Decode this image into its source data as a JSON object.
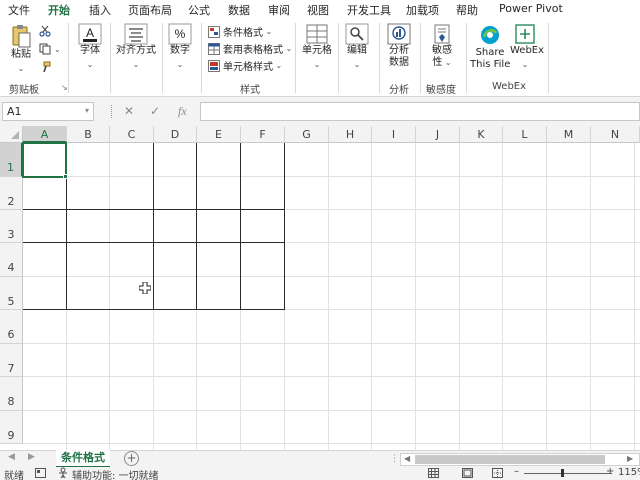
{
  "menu": {
    "tabs": [
      "文件",
      "开始",
      "插入",
      "页面布局",
      "公式",
      "数据",
      "审阅",
      "视图",
      "开发工具",
      "加载项",
      "帮助",
      "Power Pivot"
    ],
    "active_index": 1
  },
  "ribbon": {
    "clipboard": {
      "paste": "粘贴",
      "group": "剪贴板"
    },
    "font": {
      "label": "字体"
    },
    "align": {
      "label": "对齐方式"
    },
    "number": {
      "label": "数字"
    },
    "styles": {
      "conditional": "条件格式",
      "table": "套用表格格式",
      "cell": "单元格样式",
      "group": "样式"
    },
    "cells": {
      "label": "单元格"
    },
    "editing": {
      "label": "编辑"
    },
    "analysis": {
      "btn1": "分析",
      "btn2": "数据",
      "group": "分析"
    },
    "sensitivity": {
      "btn1": "敏感",
      "btn2": "性",
      "group": "敏感度"
    },
    "webex": {
      "share1": "Share",
      "share2": "This File",
      "webex": "WebEx",
      "group": "WebEx"
    }
  },
  "formula_bar": {
    "name_box": "A1",
    "cancel": "✕",
    "enter": "✓",
    "fx": "fx",
    "value": ""
  },
  "grid": {
    "columns": [
      "A",
      "B",
      "C",
      "D",
      "E",
      "F",
      "G",
      "H",
      "I",
      "J",
      "K",
      "L",
      "M",
      "N"
    ],
    "rows": [
      "1",
      "2",
      "3",
      "4",
      "5",
      "6",
      "7",
      "8",
      "9"
    ],
    "selected_cell": "A1"
  },
  "sheets": {
    "tabs": [
      "条件格式"
    ],
    "add": "+"
  },
  "status": {
    "ready": "就绪",
    "accessibility": "辅助功能: 一切就绪",
    "zoom": "115%"
  },
  "colors": {
    "accent": "#217346",
    "header_bg": "#f3f3f3"
  }
}
